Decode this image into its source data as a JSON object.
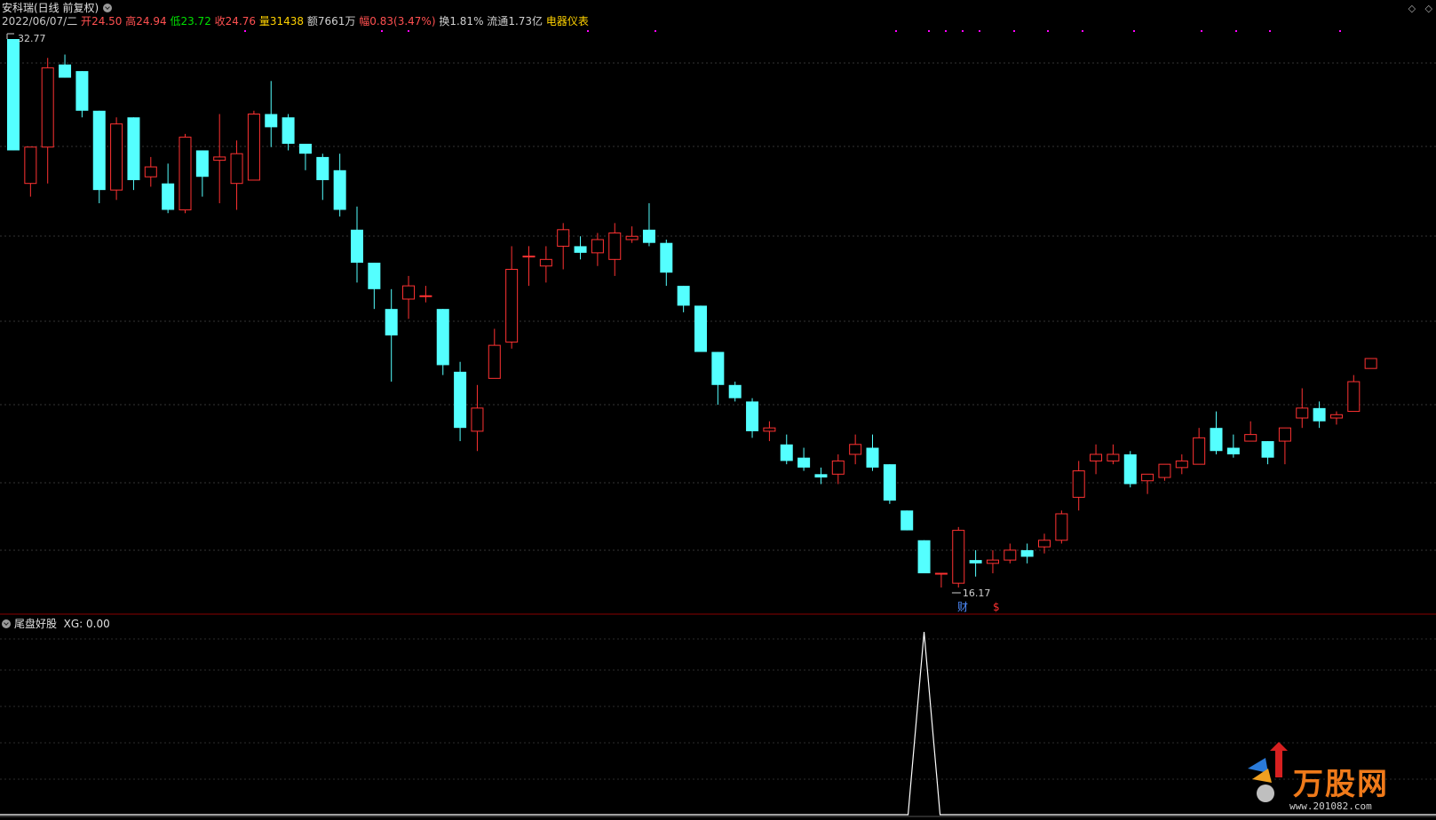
{
  "header": {
    "title": "安科瑞(日线 前复权)",
    "date": "2022/06/07/二",
    "open_label": "开",
    "open": "24.50",
    "high_label": "高",
    "high": "24.94",
    "low_label": "低",
    "low": "23.72",
    "close_label": "收",
    "close": "24.76",
    "vol_label": "量",
    "vol": "31438",
    "amt_label": "额",
    "amt": "7661万",
    "chg_label": "幅",
    "chg": "0.83(3.47%)",
    "turn_label": "换",
    "turn": "1.81%",
    "float_label": "流通",
    "float": "1.73亿",
    "sector": "电器仪表"
  },
  "colors": {
    "up": "#ff3232",
    "down": "#54ffff",
    "grid": "#3a3a3a",
    "header_up": "#ff5050",
    "sector": "#ffd200",
    "low_green": "#00e000",
    "indicator_line": "#ffffff",
    "marker_magenta": "#ff00ff"
  },
  "price_chart": {
    "max_label": "32.77",
    "min_label": "16.17",
    "event_markers": [
      {
        "label": "财",
        "color": "#4f8dff"
      },
      {
        "label": "$",
        "color": "#ff3232"
      }
    ]
  },
  "indicator": {
    "name": "尾盘好股",
    "value_label": "XG: 0.00"
  },
  "chart_data": {
    "type": "candlestick",
    "ylim": [
      16.17,
      32.77
    ],
    "candles": [
      [
        32.77,
        29.4,
        29.4,
        32.77
      ],
      [
        28.4,
        29.5,
        28.0,
        29.5
      ],
      [
        29.5,
        31.9,
        28.4,
        32.2
      ],
      [
        32.0,
        31.6,
        31.6,
        32.3
      ],
      [
        31.8,
        30.6,
        30.4,
        31.8
      ],
      [
        30.6,
        28.2,
        27.8,
        30.6
      ],
      [
        28.2,
        30.2,
        27.9,
        30.4
      ],
      [
        30.4,
        28.5,
        28.2,
        30.4
      ],
      [
        28.6,
        28.9,
        28.3,
        29.2
      ],
      [
        28.4,
        27.6,
        27.5,
        29.0
      ],
      [
        27.6,
        29.8,
        27.5,
        29.9
      ],
      [
        29.4,
        28.6,
        28.0,
        29.4
      ],
      [
        29.1,
        29.2,
        27.8,
        30.5
      ],
      [
        28.4,
        29.3,
        27.6,
        29.7
      ],
      [
        28.5,
        30.5,
        28.5,
        30.6
      ],
      [
        30.5,
        30.1,
        29.5,
        31.5
      ],
      [
        30.4,
        29.6,
        29.4,
        30.5
      ],
      [
        29.6,
        29.3,
        28.8,
        29.6
      ],
      [
        29.2,
        28.5,
        27.9,
        29.3
      ],
      [
        28.8,
        27.6,
        27.4,
        29.3
      ],
      [
        27.0,
        26.0,
        25.4,
        27.7
      ],
      [
        26.0,
        25.2,
        24.6,
        26.0
      ],
      [
        24.6,
        23.8,
        22.4,
        25.2
      ],
      [
        24.9,
        25.3,
        24.3,
        25.6
      ],
      [
        25.0,
        25.0,
        24.8,
        25.3
      ],
      [
        24.6,
        22.9,
        22.6,
        24.6
      ],
      [
        22.7,
        21.0,
        20.6,
        23.0
      ],
      [
        20.9,
        21.6,
        20.3,
        22.3
      ],
      [
        22.5,
        23.5,
        22.5,
        24.0
      ],
      [
        23.6,
        25.8,
        23.4,
        26.5
      ],
      [
        26.2,
        26.2,
        25.3,
        26.5
      ],
      [
        25.9,
        26.1,
        25.4,
        26.5
      ],
      [
        26.5,
        27.0,
        25.8,
        27.2
      ],
      [
        26.5,
        26.3,
        26.1,
        26.8
      ],
      [
        26.3,
        26.7,
        25.9,
        26.9
      ],
      [
        26.1,
        26.9,
        25.6,
        27.2
      ],
      [
        26.7,
        26.8,
        26.6,
        27.1
      ],
      [
        27.0,
        26.6,
        26.5,
        27.8
      ],
      [
        26.6,
        25.7,
        25.3,
        26.7
      ],
      [
        25.3,
        24.7,
        24.5,
        25.3
      ],
      [
        24.7,
        23.3,
        23.3,
        24.7
      ],
      [
        23.3,
        22.3,
        21.7,
        23.3
      ],
      [
        22.3,
        21.9,
        21.8,
        22.4
      ],
      [
        21.8,
        20.9,
        20.7,
        21.9
      ],
      [
        20.9,
        21.0,
        20.6,
        21.2
      ],
      [
        20.5,
        20.0,
        19.9,
        20.8
      ],
      [
        20.1,
        19.8,
        19.7,
        20.4
      ],
      [
        19.6,
        19.5,
        19.3,
        19.8
      ],
      [
        19.6,
        20.0,
        19.3,
        20.2
      ],
      [
        20.2,
        20.5,
        19.9,
        20.8
      ],
      [
        20.4,
        19.8,
        19.7,
        20.8
      ],
      [
        19.9,
        18.8,
        18.7,
        19.9
      ],
      [
        18.5,
        17.9,
        17.9,
        18.5
      ],
      [
        17.6,
        16.6,
        16.6,
        17.6
      ],
      [
        16.6,
        16.6,
        16.17,
        16.6
      ],
      [
        16.3,
        17.9,
        16.17,
        18.0
      ],
      [
        17.0,
        16.9,
        16.5,
        17.3
      ],
      [
        16.9,
        17.0,
        16.6,
        17.3
      ],
      [
        17.0,
        17.3,
        16.9,
        17.5
      ],
      [
        17.3,
        17.1,
        16.9,
        17.5
      ],
      [
        17.4,
        17.6,
        17.2,
        17.8
      ],
      [
        17.6,
        18.4,
        17.5,
        18.5
      ],
      [
        18.9,
        19.7,
        18.5,
        20.0
      ],
      [
        20.0,
        20.2,
        19.6,
        20.5
      ],
      [
        20.0,
        20.2,
        19.9,
        20.5
      ],
      [
        20.2,
        19.3,
        19.2,
        20.3
      ],
      [
        19.4,
        19.6,
        19.0,
        19.6
      ],
      [
        19.5,
        19.9,
        19.4,
        19.9
      ],
      [
        19.8,
        20.0,
        19.6,
        20.2
      ],
      [
        19.9,
        20.7,
        19.9,
        21.0
      ],
      [
        21.0,
        20.3,
        20.2,
        21.5
      ],
      [
        20.4,
        20.2,
        20.1,
        20.8
      ],
      [
        20.6,
        20.8,
        20.6,
        21.2
      ],
      [
        20.6,
        20.1,
        19.9,
        20.6
      ],
      [
        20.6,
        21.0,
        19.9,
        21.0
      ],
      [
        21.3,
        21.6,
        21.0,
        22.2
      ],
      [
        21.6,
        21.2,
        21.0,
        21.8
      ],
      [
        21.3,
        21.4,
        21.1,
        21.5
      ],
      [
        21.5,
        22.4,
        21.5,
        22.6
      ],
      [
        22.8,
        23.1,
        22.8,
        23.1
      ]
    ],
    "indicator_series": {
      "name": "XG",
      "peak_index": 53,
      "values_note_only": [
        0,
        1
      ]
    }
  }
}
